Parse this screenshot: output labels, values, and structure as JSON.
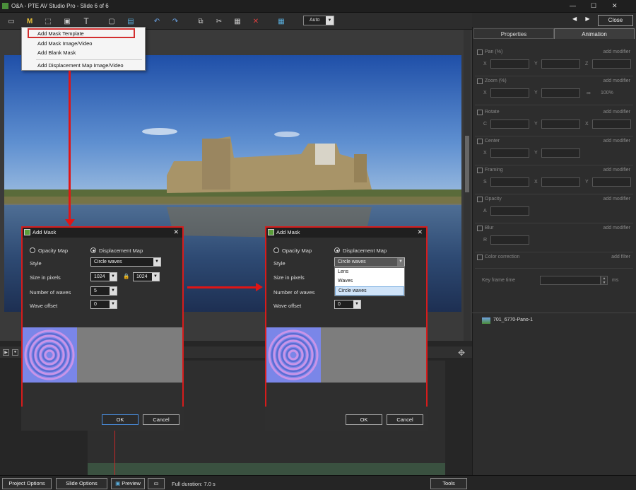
{
  "app": {
    "title": "O&A - PTE AV Studio Pro - Slide 6 of 6",
    "close_label": "Close",
    "zoom_mode": "Auto",
    "minimize_glyph": "—",
    "maximize_glyph": "☐",
    "close_glyph": "✕",
    "nav_prev": "◀",
    "nav_next": "▶"
  },
  "toolbar": {
    "icons": [
      "view-icon",
      "mask-icon",
      "frame-icon",
      "image-icon",
      "text-icon",
      "rectangle-icon",
      "picture-icon",
      "undo-icon",
      "redo-icon",
      "copy-icon",
      "cut-icon",
      "paste-icon",
      "delete-icon",
      "grid-icon"
    ]
  },
  "mask_menu": {
    "items": [
      "Add Mask Template",
      "Add Mask Image/Video",
      "Add Blank Mask",
      "Add Displacement Map Image/Video"
    ]
  },
  "dialog_left": {
    "title": "Add Mask",
    "radio_opacity": "Opacity Map",
    "radio_displacement": "Displacement Map",
    "style_label": "Style",
    "style_value": "Circle waves",
    "size_label": "Size in pixels",
    "size_w": "1024",
    "size_h": "1024",
    "waves_label": "Number of waves",
    "waves_value": "5",
    "offset_label": "Wave offset",
    "offset_value": "0",
    "ok": "OK",
    "cancel": "Cancel"
  },
  "dialog_right": {
    "title": "Add Mask",
    "radio_opacity": "Opacity Map",
    "radio_displacement": "Displacement Map",
    "style_label": "Style",
    "style_value": "Circle waves",
    "size_label": "Size in pixels",
    "waves_label": "Number of waves",
    "offset_label": "Wave offset",
    "offset_value": "0",
    "dropdown_options": [
      "Lens",
      "Waves",
      "Circle waves"
    ],
    "ok": "OK",
    "cancel": "Cancel"
  },
  "right_panel": {
    "tab_properties": "Properties",
    "tab_animation": "Animation",
    "sections": [
      {
        "name": "Pan (%)",
        "action": "add modifier",
        "fields": [
          "X",
          "Y",
          "Z"
        ]
      },
      {
        "name": "Zoom (%)",
        "action": "add modifier",
        "fields": [
          "X",
          "Y"
        ],
        "extra": "100%"
      },
      {
        "name": "Rotate",
        "action": "add modifier",
        "fields": [
          "C",
          "Y",
          "X"
        ]
      },
      {
        "name": "Center",
        "action": "add modifier",
        "fields": [
          "X",
          "Y"
        ]
      },
      {
        "name": "Framing",
        "action": "add modifier",
        "fields": [
          "S",
          "X",
          "Y"
        ]
      },
      {
        "name": "Opacity",
        "action": "add modifier",
        "fields": [
          "A"
        ]
      },
      {
        "name": "Blur",
        "action": "add modifier",
        "fields": [
          "R"
        ]
      }
    ],
    "color_correction": "Color correction",
    "add_filter": "add filter",
    "keyframe_label": "Key frame time",
    "keyframe_unit": "ms",
    "file_name": "701_6770-Pano-1"
  },
  "bottom": {
    "project_options": "Project Options",
    "slide_options": "Slide Options",
    "preview": "Preview",
    "duration": "Full duration: 7.0 s",
    "tools": "Tools"
  }
}
